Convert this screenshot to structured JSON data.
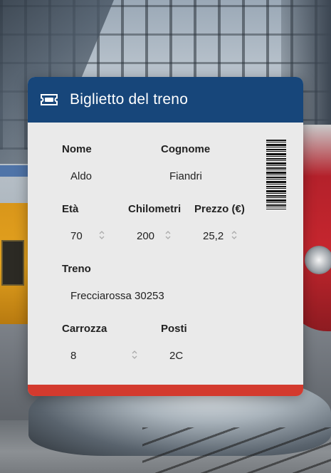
{
  "card": {
    "title": "Biglietto del treno",
    "header_color": "#17467a",
    "footer_color": "#d33a2e"
  },
  "fields": {
    "nome": {
      "label": "Nome",
      "value": "Aldo"
    },
    "cognome": {
      "label": "Cognome",
      "value": "Fiandri"
    },
    "eta": {
      "label": "Età",
      "value": "70"
    },
    "chilometri": {
      "label": "Chilometri",
      "value": "200"
    },
    "prezzo": {
      "label": "Prezzo (€)",
      "value": "25,2"
    },
    "treno": {
      "label": "Treno",
      "value": "Frecciarossa 30253"
    },
    "carrozza": {
      "label": "Carrozza",
      "value": "8"
    },
    "posti": {
      "label": "Posti",
      "value": "2C"
    }
  },
  "icons": {
    "header": "ticket-icon",
    "code": "barcode-icon"
  }
}
